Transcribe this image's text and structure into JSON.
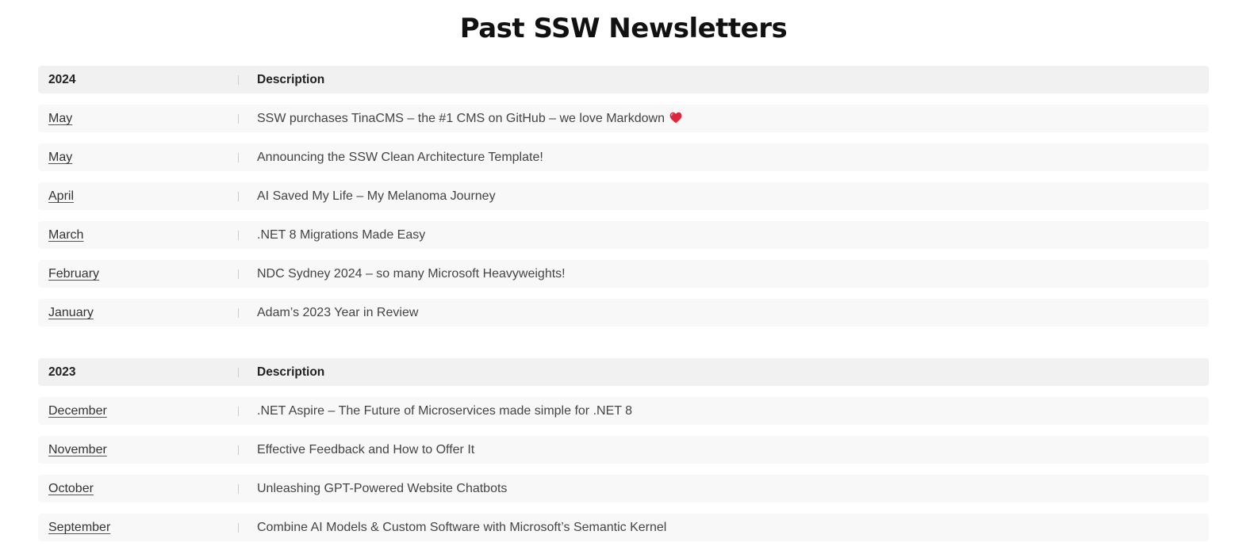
{
  "page": {
    "title": "Past SSW Newsletters"
  },
  "colors": {
    "header_row_bg": "#f1f1f1",
    "row_bg": "#f8f8f8",
    "heart": "#e0243a"
  },
  "years": [
    {
      "year": "2024",
      "description_header": "Description",
      "rows": [
        {
          "month": "May",
          "description": "SSW purchases TinaCMS – the #1 CMS on GitHub – we love Markdown",
          "icon": "heart-icon"
        },
        {
          "month": "May",
          "description": "Announcing the SSW Clean Architecture Template!"
        },
        {
          "month": "April",
          "description": "AI Saved My Life – My Melanoma Journey"
        },
        {
          "month": "March",
          "description": ".NET 8 Migrations Made Easy"
        },
        {
          "month": "February",
          "description": "NDC Sydney 2024 – so many Microsoft Heavyweights!"
        },
        {
          "month": "January",
          "description": "Adam’s 2023 Year in Review"
        }
      ]
    },
    {
      "year": "2023",
      "description_header": "Description",
      "rows": [
        {
          "month": "December",
          "description": ".NET Aspire – The Future of Microservices made simple for .NET 8"
        },
        {
          "month": "November",
          "description": "Effective Feedback and How to Offer It"
        },
        {
          "month": "October",
          "description": "Unleashing GPT-Powered Website Chatbots"
        },
        {
          "month": "September",
          "description": "Combine AI Models & Custom Software with Microsoft’s Semantic Kernel"
        }
      ]
    }
  ]
}
